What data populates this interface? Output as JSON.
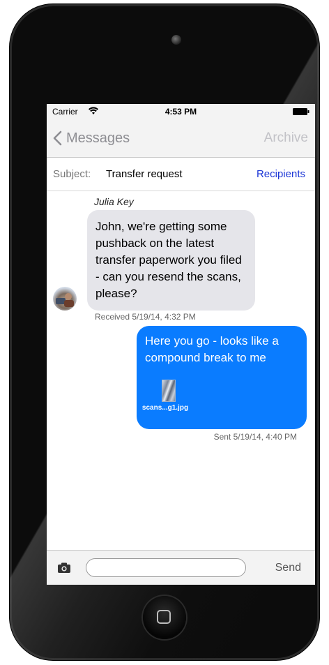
{
  "status_bar": {
    "carrier": "Carrier",
    "time": "4:53 PM",
    "wifi_icon": "wifi-icon",
    "battery_icon": "battery-icon"
  },
  "nav": {
    "back_label": "Messages",
    "back_icon": "chevron-left-icon",
    "archive_label": "Archive"
  },
  "subject": {
    "label": "Subject:",
    "value": "Transfer request",
    "recipients_label": "Recipients"
  },
  "messages": [
    {
      "direction": "incoming",
      "sender": "Julia Key",
      "text": "John, we're getting some pushback on the latest transfer paperwork you filed - can you resend the scans, please?",
      "meta": "Received 5/19/14, 4:32 PM"
    },
    {
      "direction": "outgoing",
      "text": "Here you go - looks like a compound break to me",
      "attachment_name": "scans...g1.jpg",
      "meta": "Sent 5/19/14, 4:40 PM"
    }
  ],
  "composer": {
    "camera_icon": "camera-icon",
    "input_value": "",
    "send_label": "Send"
  },
  "colors": {
    "outgoing_bubble": "#0a7cff",
    "incoming_bubble": "#e5e5ea",
    "link_blue": "#1b36d6",
    "nav_gray": "#8e8e93"
  }
}
